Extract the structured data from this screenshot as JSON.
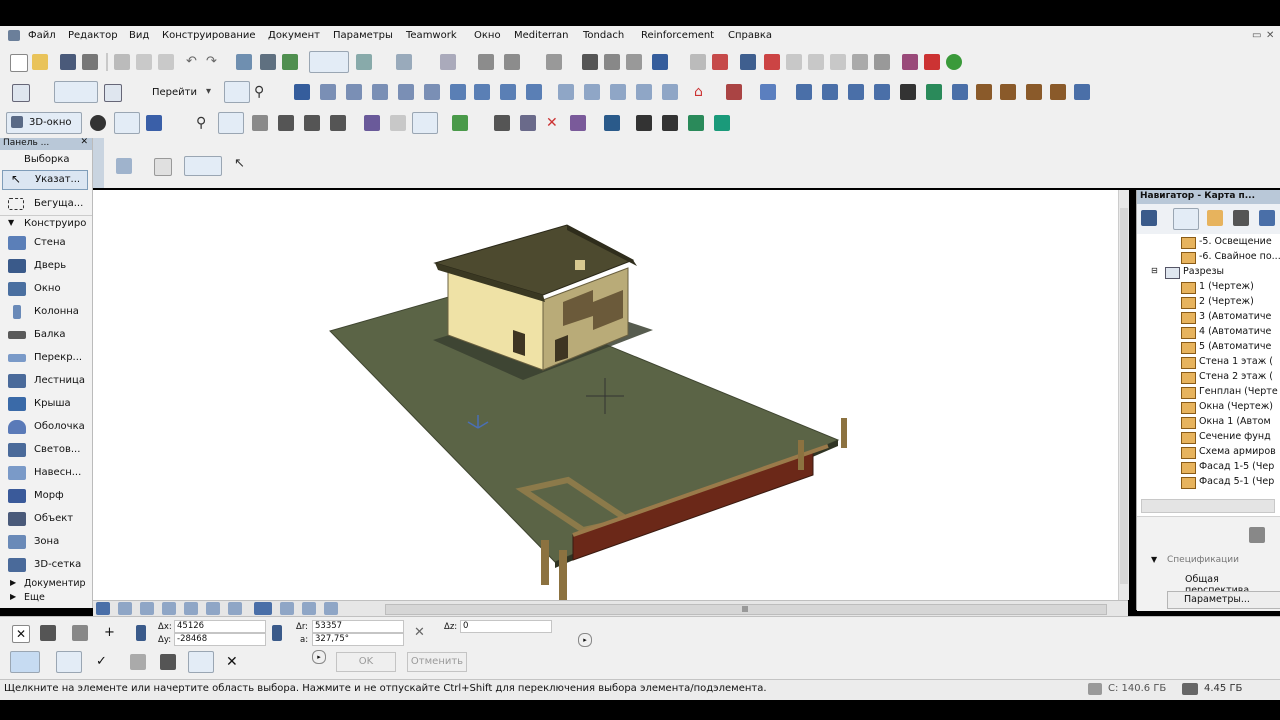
{
  "menu": [
    "Файл",
    "Редактор",
    "Вид",
    "Конструирование",
    "Документ",
    "Параметры",
    "Teamwork",
    "Окно",
    "Mediterran",
    "Tondach",
    "Reinforcement",
    "Справка"
  ],
  "toolbar": {
    "goto_label": "Перейти",
    "view3d_label": "3D-окно"
  },
  "left_panel": {
    "title": "Панель ...",
    "select_header": "Выборка",
    "arrow_tool": "Указат...",
    "marquee_tool": "Бегуща...",
    "design_header": "Конструиро",
    "tools": [
      "Стена",
      "Дверь",
      "Окно",
      "Колонна",
      "Балка",
      "Перекр...",
      "Лестница",
      "Крыша",
      "Оболочка",
      "Светов...",
      "Навесн...",
      "Морф",
      "Объект",
      "Зона",
      "3D-сетка"
    ],
    "doc_header": "Документир",
    "more_header": "Еще"
  },
  "navigator": {
    "title": "Навигатор - Карта п...",
    "items_top": [
      "-5. Освещение",
      "-6. Свайное по..."
    ],
    "section_folder": "Разрезы",
    "items": [
      "1 (Чертеж)",
      "2 (Чертеж)",
      "3 (Автоматиче",
      "4 (Автоматиче",
      "5 (Автоматиче",
      "Стена 1 этаж (",
      "Стена 2 этаж (",
      "Генплан (Черте",
      "Окна (Чертеж)",
      "Окна 1 (Автом",
      "Сечение фунд",
      "Схема армиров",
      "Фасад 1-5 (Чер",
      "Фасад 5-1 (Чер"
    ],
    "spec_label": "Спецификации",
    "persp_label": "Общая перспектива",
    "params_button": "Параметры..."
  },
  "coords": {
    "ax_label": "Δx:",
    "ax_value": "45126",
    "ay_label": "Δy:",
    "ay_value": "-28468",
    "ar_label": "Δr:",
    "ar_value": "53357",
    "angle_label": "a:",
    "angle_value": "327,75°",
    "az_label": "Δz:",
    "az_value": "0"
  },
  "buttons": {
    "ok": "OK",
    "cancel": "Отменить"
  },
  "status": {
    "message": "Щелкните на элементе или начертите область выбора. Нажмите и не отпускайте Ctrl+Shift для переключения выбора элемента/подэлемента.",
    "disk_c": "C: 140.6 ГБ",
    "memory": "4.45 ГБ"
  },
  "colors": {
    "ground": "#5a6446",
    "roof": "#4d4a2f",
    "walls": "#efe2a6",
    "fence": "#6b2818",
    "navy_select": "#c6dbf2"
  }
}
